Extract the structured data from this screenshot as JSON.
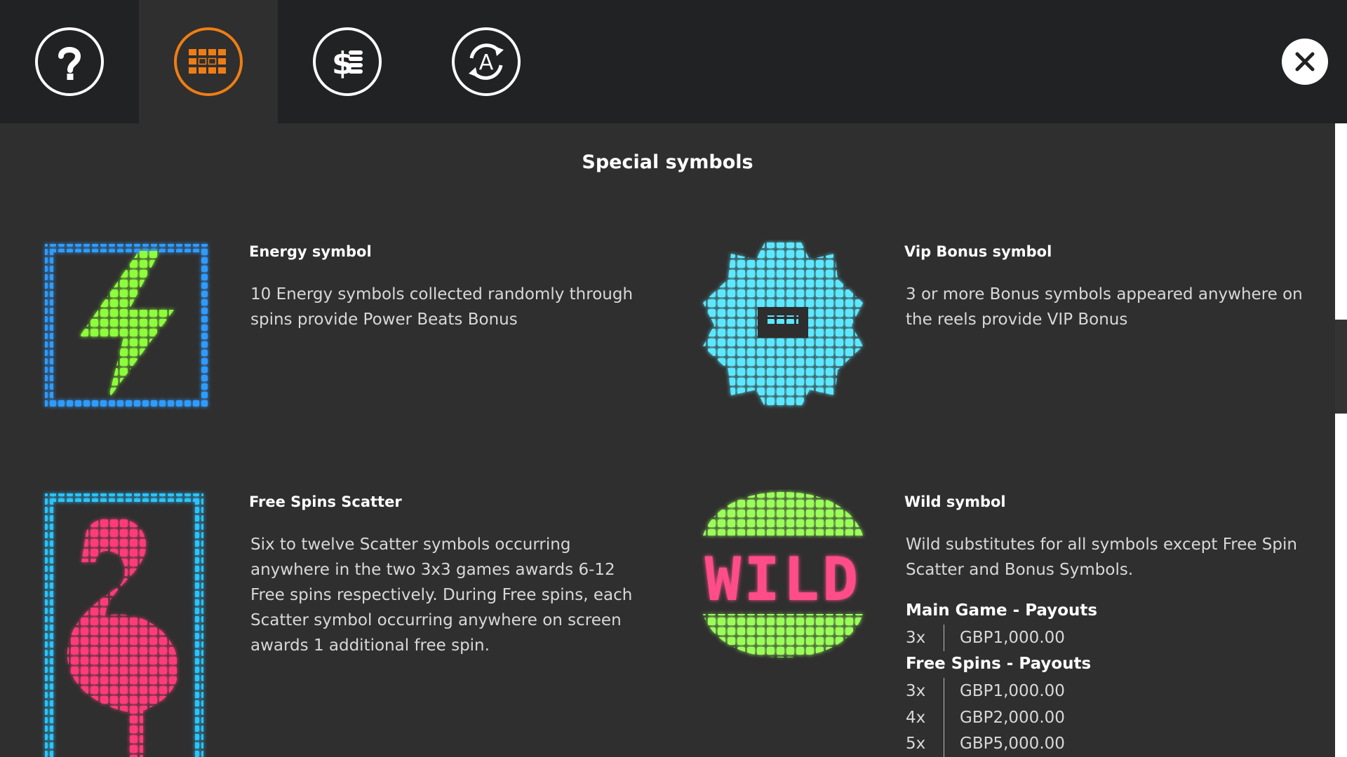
{
  "tabs": [
    {
      "name": "help-tab",
      "icon": "question-mark-icon"
    },
    {
      "name": "paytable-tab",
      "icon": "grid-icon",
      "active": true
    },
    {
      "name": "bet-tab",
      "icon": "dollar-coins-icon"
    },
    {
      "name": "autoplay-tab",
      "icon": "autoplay-icon"
    }
  ],
  "close_icon": "close-icon",
  "page_title": "Special symbols",
  "symbols": {
    "energy": {
      "title": "Energy symbol",
      "desc": "10 Energy symbols collected randomly through spins provide Power Beats Bonus",
      "icon": "lightning-icon"
    },
    "vip": {
      "title": "Vip Bonus symbol",
      "desc": "3 or more Bonus symbols appeared anywhere on the reels provide VIP Bonus",
      "icon": "vip-bonus-icon"
    },
    "scatter": {
      "title": "Free Spins Scatter",
      "desc": "Six to twelve Scatter symbols occurring anywhere in the two 3x3 games awards 6-12 Free spins respectively. During Free spins, each Scatter symbol occurring anywhere on screen awards 1 additional free spin.",
      "icon": "flamingo-icon"
    },
    "wild": {
      "title": "Wild symbol",
      "desc": "Wild substitutes for all symbols except Free Spin Scatter and Bonus Symbols.",
      "icon_text": "WILD",
      "main_title": "Main Game - Payouts",
      "main": [
        {
          "mult": "3x",
          "value": "GBP1,000.00"
        }
      ],
      "free_title": "Free Spins - Payouts",
      "free": [
        {
          "mult": "3x",
          "value": "GBP1,000.00"
        },
        {
          "mult": "4x",
          "value": "GBP2,000.00"
        },
        {
          "mult": "5x",
          "value": "GBP5,000.00"
        }
      ]
    }
  },
  "colors": {
    "accent": "#f07d14",
    "energy_green": "#7dff3a",
    "frame_blue": "#2f7dff",
    "vip_cyan": "#5de8ff",
    "flamingo_pink": "#ff3b7a",
    "wild_pink": "#ff4d8a",
    "wild_green": "#9bff5a"
  }
}
